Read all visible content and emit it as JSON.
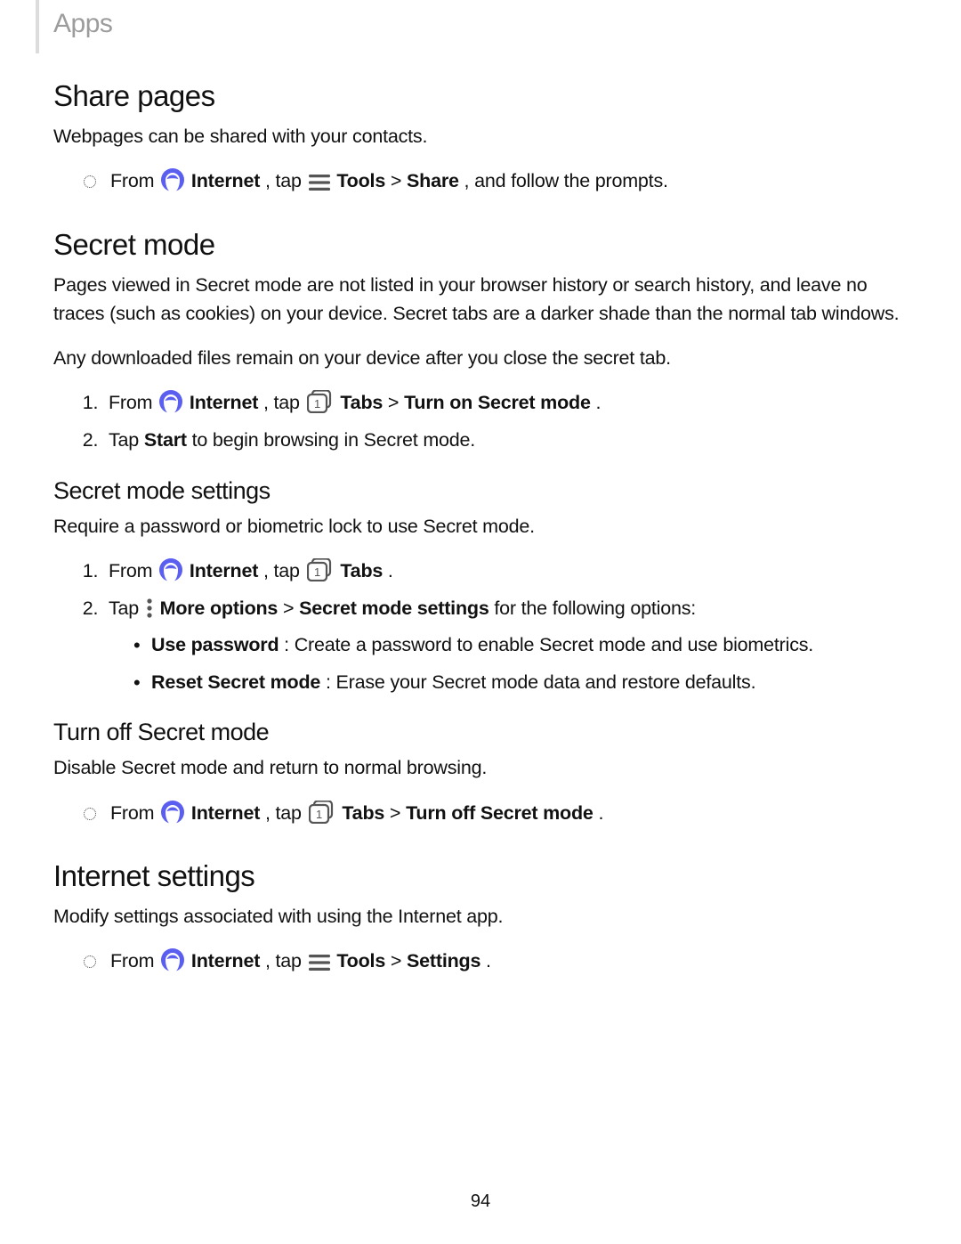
{
  "header": {
    "title": "Apps"
  },
  "share_pages": {
    "heading": "Share pages",
    "intro": "Webpages can be shared with your contacts.",
    "bullet_from": "From ",
    "internet": " Internet",
    "tap": ", tap ",
    "tools": " Tools",
    "gt": " > ",
    "share": "Share",
    "tail": ", and follow the prompts."
  },
  "secret_mode": {
    "heading": "Secret mode",
    "p1": "Pages viewed in Secret mode are not listed in your browser history or search history, and leave no traces (such as cookies) on your device. Secret tabs are a darker shade than the normal tab windows.",
    "p2": "Any downloaded files remain on your device after you close the secret tab.",
    "step1_from": "From ",
    "step1_internet": " Internet",
    "step1_tap": ", tap ",
    "step1_tabs": " Tabs",
    "step1_gt": " > ",
    "step1_action": "Turn on Secret mode",
    "step1_end": ".",
    "step2_a": "Tap ",
    "step2_b": "Start",
    "step2_c": " to begin browsing in Secret mode."
  },
  "secret_settings": {
    "heading": "Secret mode settings",
    "intro": "Require a password or biometric lock to use Secret mode.",
    "step1_from": "From ",
    "step1_internet": " Internet",
    "step1_tap": ", tap ",
    "step1_tabs": " Tabs",
    "step1_end": ".",
    "step2_a": "Tap ",
    "step2_more": " More options",
    "step2_gt": " > ",
    "step2_sms": "Secret mode settings",
    "step2_tail": " for the following options:",
    "opt1_label": "Use password",
    "opt1_text": ": Create a password to enable Secret mode and use biometrics.",
    "opt2_label": "Reset Secret mode",
    "opt2_text": ": Erase your Secret mode data and restore defaults."
  },
  "turn_off": {
    "heading": "Turn off Secret mode",
    "intro": "Disable Secret mode and return to normal browsing.",
    "bullet_from": "From ",
    "internet": " Internet",
    "tap": ", tap ",
    "tabs": " Tabs",
    "gt": " > ",
    "action": "Turn off Secret mode",
    "end": "."
  },
  "internet_settings": {
    "heading": "Internet settings",
    "intro": "Modify settings associated with using the Internet app.",
    "bullet_from": "From ",
    "internet": " Internet",
    "tap": ", tap ",
    "tools": " Tools",
    "gt": " > ",
    "settings": "Settings",
    "end": "."
  },
  "page_number": "94"
}
